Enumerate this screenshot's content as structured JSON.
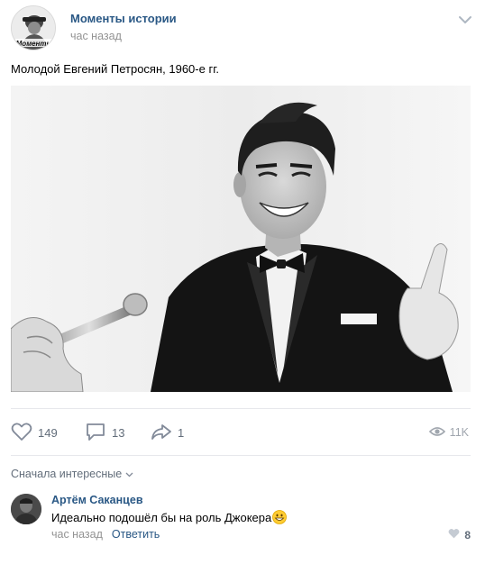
{
  "post": {
    "group_name": "Моменты истории",
    "avatar_text": "Моменты",
    "time": "час назад",
    "text": "Молодой Евгений Петросян, 1960-е гг."
  },
  "actions": {
    "likes": "149",
    "comments": "13",
    "shares": "1",
    "views": "11K"
  },
  "comments_section": {
    "sort_label": "Сначала интересные",
    "comment": {
      "author": "Артём Саканцев",
      "text": "Идеально подошёл бы на роль Джокера",
      "time": "час назад",
      "reply_label": "Ответить",
      "likes": "8"
    }
  },
  "colors": {
    "link": "#2a5885",
    "muted": "#939393",
    "divider": "#e7e8ec"
  }
}
